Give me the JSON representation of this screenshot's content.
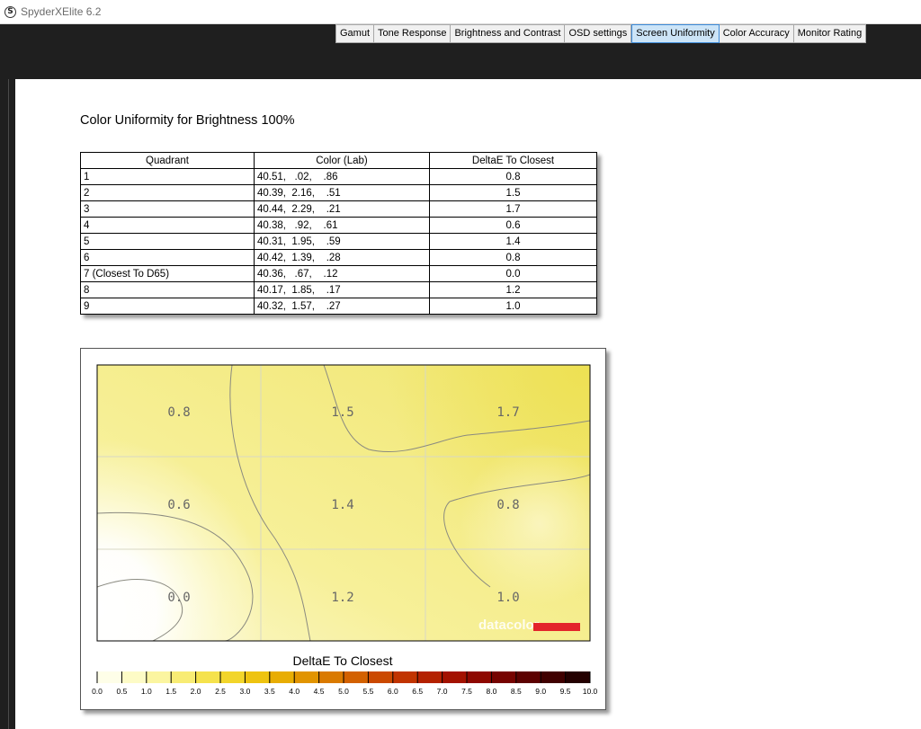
{
  "window": {
    "app_icon_letter": "S",
    "title": "SpyderXElite 6.2"
  },
  "tabs": [
    {
      "label": "Gamut",
      "active": false
    },
    {
      "label": "Tone Response",
      "active": false
    },
    {
      "label": "Brightness and Contrast",
      "active": false
    },
    {
      "label": "OSD settings",
      "active": false
    },
    {
      "label": "Screen Uniformity",
      "active": true
    },
    {
      "label": "Color Accuracy",
      "active": false
    },
    {
      "label": "Monitor Rating",
      "active": false
    }
  ],
  "report": {
    "title": "Color Uniformity for Brightness 100%",
    "table": {
      "headers": [
        "Quadrant",
        "Color (Lab)",
        "DeltaE To Closest"
      ],
      "rows": [
        [
          "1",
          "40.51,   .02,    .86",
          "0.8"
        ],
        [
          "2",
          "40.39,  2.16,    .51",
          "1.5"
        ],
        [
          "3",
          "40.44,  2.29,    .21",
          "1.7"
        ],
        [
          "4",
          "40.38,   .92,    .61",
          "0.6"
        ],
        [
          "5",
          "40.31,  1.95,    .59",
          "1.4"
        ],
        [
          "6",
          "40.42,  1.39,    .28",
          "0.8"
        ],
        [
          "7 (Closest To D65)",
          "40.36,   .67,    .12",
          "0.0"
        ],
        [
          "8",
          "40.17,  1.85,    .17",
          "1.2"
        ],
        [
          "9",
          "40.32,  1.57,    .27",
          "1.0"
        ]
      ]
    },
    "uniformity_map": {
      "grid_values": [
        [
          "0.8",
          "1.5",
          "1.7"
        ],
        [
          "0.6",
          "1.4",
          "0.8"
        ],
        [
          "0.0",
          "1.2",
          "1.0"
        ]
      ],
      "watermark": "datacolor",
      "watermark_color": "#e3242b",
      "legend_title": "DeltaE To Closest",
      "legend_ticks": [
        "0.0",
        "0.5",
        "1.0",
        "1.5",
        "2.0",
        "2.5",
        "3.0",
        "3.5",
        "4.0",
        "4.5",
        "5.0",
        "5.5",
        "6.0",
        "6.5",
        "7.0",
        "7.5",
        "8.0",
        "8.5",
        "9.0",
        "9.5",
        "10.0"
      ],
      "legend_colors": [
        "#fefee8",
        "#fdfbc6",
        "#fbf5a0",
        "#f8ec74",
        "#f5e24c",
        "#f2d52a",
        "#eec310",
        "#e8ad03",
        "#e19400",
        "#da7a00",
        "#d36100",
        "#cb4900",
        "#c13400",
        "#b42100",
        "#a31200",
        "#8e0800",
        "#760300",
        "#5c0100",
        "#400000",
        "#240000"
      ]
    }
  }
}
